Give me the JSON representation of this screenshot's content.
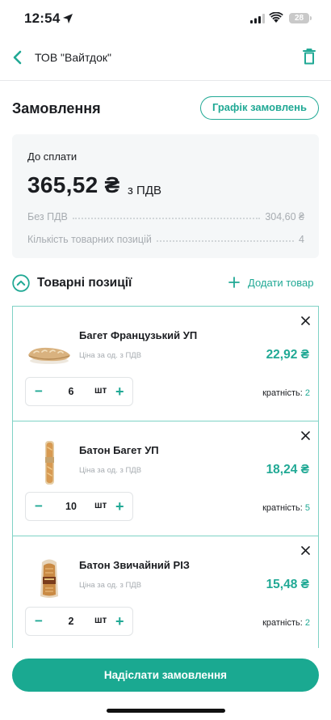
{
  "status_bar": {
    "time": "12:54",
    "battery": "28"
  },
  "header": {
    "title": "ТОВ \"Вайтдок\""
  },
  "order": {
    "title": "Замовлення",
    "schedule_button": "Графік замовлень",
    "pay_label": "До сплати",
    "total": "365,52 ₴",
    "total_vat": "з ПДВ",
    "without_vat_label": "Без ПДВ",
    "without_vat_value": "304,60 ₴",
    "positions_label": "Кількість товарних позицій",
    "positions_value": "4"
  },
  "items_section": {
    "title": "Товарні позиції",
    "add_label": "Додати товар"
  },
  "items": [
    {
      "name": "Багет Французький УП",
      "price_caption": "Ціна за од. з ПДВ",
      "price": "22,92 ₴",
      "quantity": "6",
      "unit": "шт",
      "multiplicity_label": "кратність:",
      "multiplicity": "2"
    },
    {
      "name": "Батон Багет УП",
      "price_caption": "Ціна за од. з ПДВ",
      "price": "18,24 ₴",
      "quantity": "10",
      "unit": "шт",
      "multiplicity_label": "кратність:",
      "multiplicity": "5"
    },
    {
      "name": "Батон Звичайний РІЗ",
      "price_caption": "Ціна за од. з ПДВ",
      "price": "15,48 ₴",
      "quantity": "2",
      "unit": "шт",
      "multiplicity_label": "кратність:",
      "multiplicity": "2"
    }
  ],
  "footer": {
    "submit_button": "Надіслати замовлення"
  },
  "colors": {
    "accent": "#21a995",
    "text": "#1b1d21",
    "muted": "#a7acb1"
  },
  "icons": [
    "location-arrow-icon",
    "signal-icon",
    "wifi-icon",
    "back-chevron-icon",
    "trash-icon",
    "chevron-up-circle-icon",
    "plus-icon",
    "close-icon",
    "minus-icon"
  ]
}
